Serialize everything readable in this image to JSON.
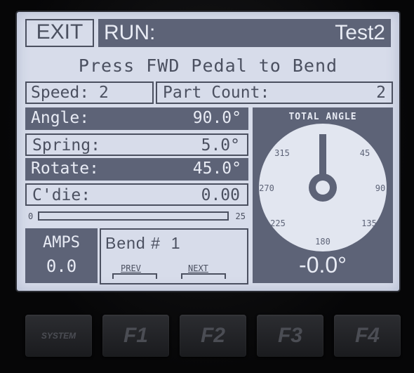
{
  "header": {
    "exit_label": "EXIT",
    "run_label": "RUN:",
    "program_name": "Test2"
  },
  "prompt": "Press FWD Pedal to Bend",
  "speed": {
    "label": "Speed:",
    "value": "2"
  },
  "part_count": {
    "label": "Part Count:",
    "value": "2"
  },
  "params": [
    {
      "label": "Angle:",
      "value": "90.0°"
    },
    {
      "label": "Spring:",
      "value": "5.0°"
    },
    {
      "label": "Rotate:",
      "value": "45.0°"
    },
    {
      "label": "C'die:",
      "value": "0.00"
    }
  ],
  "progress": {
    "min_label": "0",
    "max_label": "25",
    "value": 0
  },
  "amps": {
    "label": "AMPS",
    "value": "0.0"
  },
  "bend": {
    "label": "Bend #",
    "value": "1",
    "prev_label": "PREV",
    "next_label": "NEXT"
  },
  "gauge": {
    "title": "TOTAL ANGLE",
    "ticks": [
      "315",
      "45",
      "270",
      "90",
      "225",
      "135",
      "180"
    ],
    "readout": "-0.0°"
  },
  "hardware_keys": [
    "SYSTEM",
    "F1",
    "F2",
    "F3",
    "F4"
  ],
  "colors": {
    "screen_bg": "#d7dcea",
    "ink": "#4b5060",
    "inverse_fill": "#5d6377",
    "bezel": "#0b0b0c"
  }
}
